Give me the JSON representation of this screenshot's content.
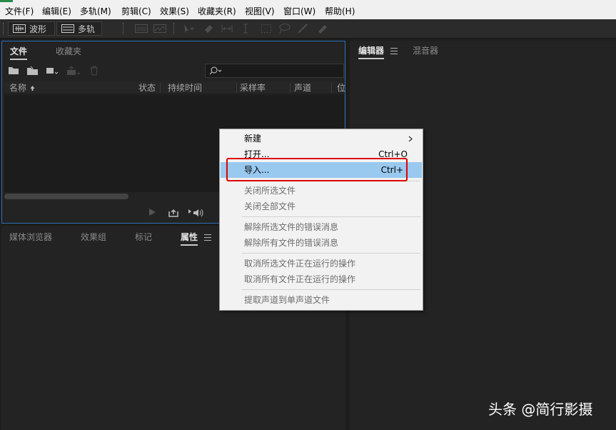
{
  "menubar": {
    "items": [
      "文件(F)",
      "编辑(E)",
      "多轨(M)",
      "剪辑(C)",
      "效果(S)",
      "收藏夹(R)",
      "视图(V)",
      "窗口(W)",
      "帮助(H)"
    ]
  },
  "toolbar": {
    "waveform_label": "波形",
    "multitrack_label": "多轨"
  },
  "files_panel": {
    "tabs": [
      "文件",
      "收藏夹"
    ],
    "columns": [
      "名称",
      "状态",
      "持续时间",
      "采样率",
      "声道",
      "位"
    ]
  },
  "lower_panel": {
    "tabs": [
      "媒体浏览器",
      "效果组",
      "标记",
      "属性"
    ]
  },
  "editor_panel": {
    "tabs": [
      "编辑器",
      "混音器"
    ]
  },
  "context_menu": {
    "items": [
      {
        "label": "新建",
        "shortcut": ""
      },
      {
        "label": "打开...",
        "shortcut": "Ctrl+O"
      },
      {
        "label": "导入...",
        "shortcut": "Ctrl+"
      },
      {
        "label": "关闭所选文件",
        "shortcut": ""
      },
      {
        "label": "关闭全部文件",
        "shortcut": ""
      },
      {
        "label": "解除所选文件的错误消息",
        "shortcut": ""
      },
      {
        "label": "解除所有文件的错误消息",
        "shortcut": ""
      },
      {
        "label": "取消所选文件正在运行的操作",
        "shortcut": ""
      },
      {
        "label": "取消所有文件正在运行的操作",
        "shortcut": ""
      },
      {
        "label": "提取声道到单声道文件",
        "shortcut": ""
      }
    ]
  },
  "watermark": "头条 @简行影摄",
  "icons": {
    "new-folder": "folder-icon",
    "import": "import-file-icon",
    "insert": "insert-icon",
    "export": "export-icon",
    "delete": "trash-icon",
    "search": "search-icon",
    "play": "play-icon",
    "loop": "loop-icon",
    "auto-play": "auto-play-icon"
  },
  "colors": {
    "menu_highlight": "#99c9ef",
    "focus_border": "#2e6fb8",
    "annotation_red": "#e00000"
  }
}
